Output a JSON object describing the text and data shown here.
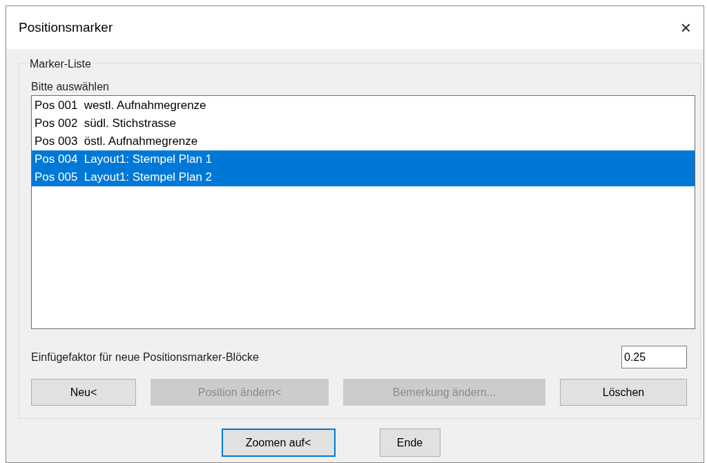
{
  "window": {
    "title": "Positionsmarker",
    "close": "×"
  },
  "group": {
    "title": "Marker-Liste",
    "list_label": "Bitte auswählen",
    "items": [
      {
        "pos": "Pos 001",
        "text": "westl. Aufnahmegrenze",
        "selected": false
      },
      {
        "pos": "Pos 002",
        "text": "südl. Stichstrasse",
        "selected": false
      },
      {
        "pos": "Pos 003",
        "text": "östl. Aufnahmegrenze",
        "selected": false
      },
      {
        "pos": "Pos 004",
        "text": "Layout1: Stempel Plan 1",
        "selected": true
      },
      {
        "pos": "Pos 005",
        "text": "Layout1: Stempel Plan 2",
        "selected": true
      }
    ],
    "factor_label": "Einfügefaktor für neue Positionsmarker-Blöcke",
    "factor_value": "0.25",
    "buttons": [
      {
        "label": "Neu<",
        "disabled": false
      },
      {
        "label": "Position ändern<",
        "disabled": true
      },
      {
        "label": "Bemerkung ändern...",
        "disabled": true
      },
      {
        "label": "Löschen",
        "disabled": false
      }
    ]
  },
  "footer_buttons": [
    {
      "label": "Zoomen auf<",
      "default": true
    },
    {
      "label": "Ende",
      "default": false
    }
  ]
}
